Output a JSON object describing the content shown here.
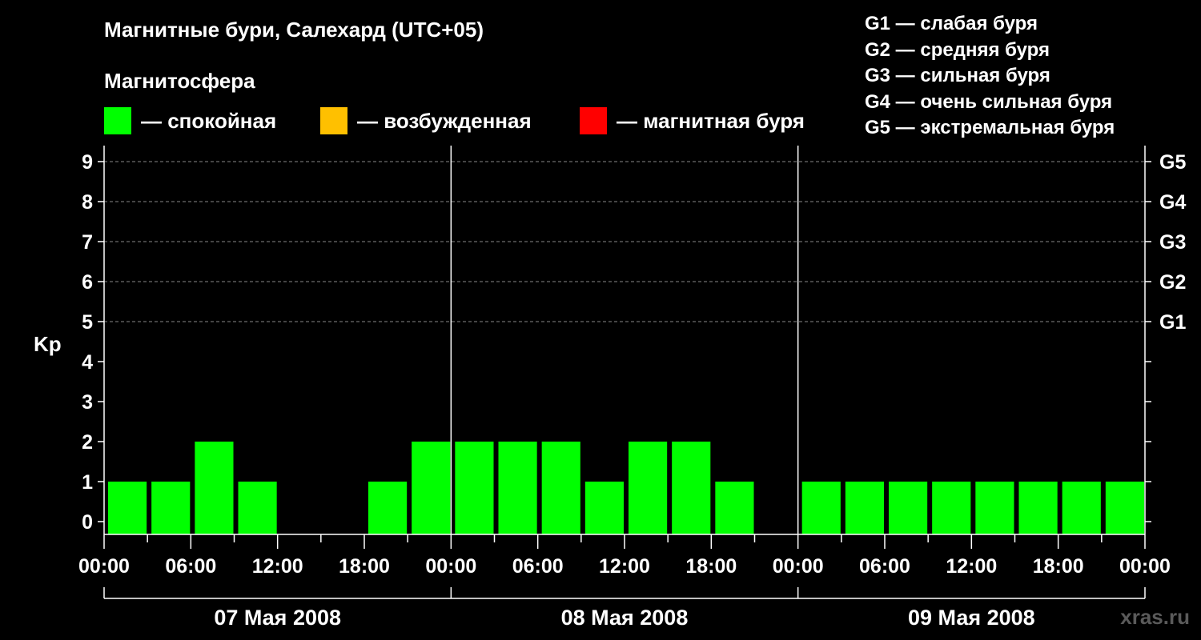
{
  "header": {
    "title": "Магнитные бури, Салехард (UTC+05)",
    "magnetosphere_label": "Магнитосфера"
  },
  "legend": [
    {
      "color": "#00ff00",
      "label": "— спокойная"
    },
    {
      "color": "#ffc000",
      "label": "— возбужденная"
    },
    {
      "color": "#ff0000",
      "label": "— магнитная буря"
    }
  ],
  "g_scale": [
    "G1 — слабая буря",
    "G2 — средняя буря",
    "G3 — сильная буря",
    "G4 — очень сильная буря",
    "G5 — экстремальная буря"
  ],
  "watermark": "xras.ru",
  "chart_data": {
    "type": "bar",
    "ylabel": "Kp",
    "ylim": [
      0,
      9
    ],
    "y_ticks": [
      "0",
      "1",
      "2",
      "3",
      "4",
      "5",
      "6",
      "7",
      "8",
      "9"
    ],
    "right_ticks": [
      {
        "value": 5,
        "label": "G1"
      },
      {
        "value": 6,
        "label": "G2"
      },
      {
        "value": 7,
        "label": "G3"
      },
      {
        "value": 8,
        "label": "G4"
      },
      {
        "value": 9,
        "label": "G5"
      }
    ],
    "x_tick_labels": [
      "00:00",
      "06:00",
      "12:00",
      "18:00",
      "00:00",
      "06:00",
      "12:00",
      "18:00",
      "00:00",
      "06:00",
      "12:00",
      "18:00",
      "00:00"
    ],
    "days": [
      "07 Мая 2008",
      "08 Мая 2008",
      "09 Мая 2008"
    ],
    "interval_hours": 3,
    "values": [
      1,
      1,
      2,
      1,
      0,
      0,
      1,
      2,
      2,
      2,
      2,
      1,
      2,
      2,
      1,
      0,
      1,
      1,
      1,
      1,
      1,
      1,
      1,
      1
    ],
    "bar_color": "#00ff00",
    "grid": true
  }
}
